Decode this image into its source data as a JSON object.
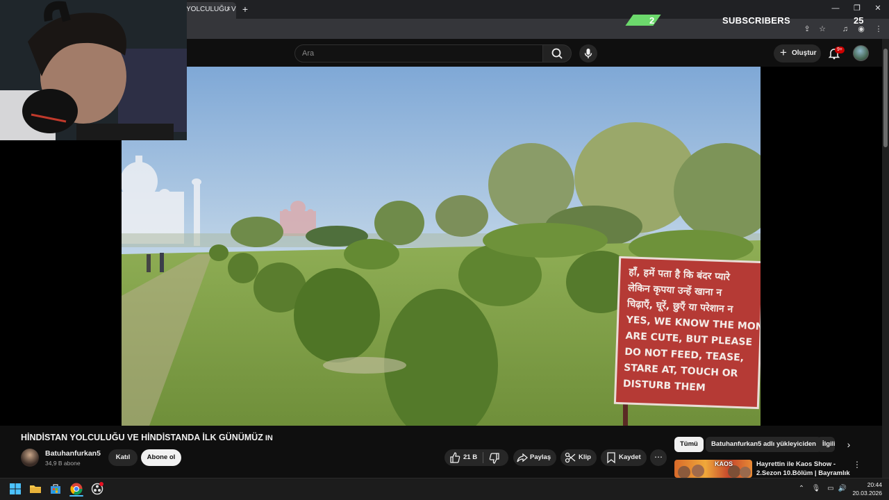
{
  "browser": {
    "tab_title": "YOLCULUĞU VE",
    "tab_close": "×",
    "new_tab": "+",
    "window_controls": [
      "—",
      "❐",
      "✕"
    ]
  },
  "stream_overlay": {
    "subscriber_count": "2",
    "label": "SUBSCRIBERS",
    "goal": "25",
    "accent_color": "#6cd96c"
  },
  "masthead": {
    "search_placeholder": "Ara",
    "create_label": "Oluştur",
    "notification_badge": "9+"
  },
  "video": {
    "title": "HİNDİSTAN YOLCULUĞU VE HİNDİSTANDA İLK GÜNÜMÜZ",
    "title_badge": "IN",
    "sign_lines": [
      "हाँ, हमें पता है कि बंदर प्यारे",
      "लेकिन कृपया उन्हें खाना न",
      "चिढ़ाएँ, घूरें, छुएँ या परेशान न",
      "YES, WE KNOW THE MONK",
      "ARE CUTE, BUT PLEASE",
      "DO NOT FEED, TEASE,",
      "STARE AT, TOUCH OR",
      "DISTURB THEM"
    ]
  },
  "channel": {
    "name": "Batuhanfurkan5",
    "subscribers": "34,9 B abone",
    "join_label": "Katıl",
    "subscribe_label": "Abone ol"
  },
  "actions": {
    "like_count": "21 B",
    "share_label": "Paylaş",
    "clip_label": "Klip",
    "save_label": "Kaydet",
    "more_label": "⋯"
  },
  "recommendations": {
    "chips": [
      "Tümü",
      "Batuhanfurkan5 adlı yükleyiciden",
      "İlgili"
    ],
    "first_title": "Hayrettin ile Kaos Show - 2.Sezon 10.Bölüm | Bayramlık ...",
    "thumb_text": "KAOS"
  },
  "taskbar": {
    "time": "20:44",
    "date": "20.03.2026"
  }
}
